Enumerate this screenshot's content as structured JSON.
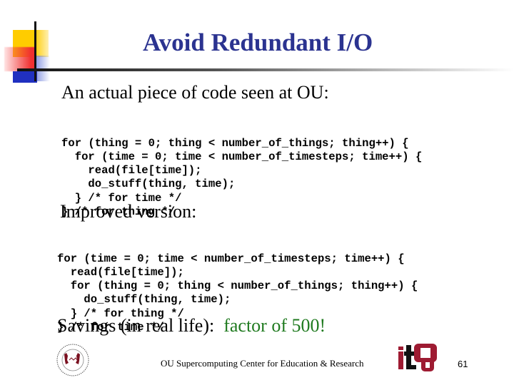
{
  "slide": {
    "title": "Avoid Redundant I/O",
    "intro": "An actual piece of code seen at OU:",
    "original_code": [
      "for (thing = 0; thing < number_of_things; thing++) {",
      "  for (time = 0; time < number_of_timesteps; time++) {",
      "    read(file[time]);",
      "    do_stuff(thing, time);",
      "  } /* for time */",
      "} /* for thing */"
    ],
    "improved_label": "Improved version:",
    "improved_code": [
      "for (time = 0; time < number_of_timesteps; time++) {",
      "  read(file[time]);",
      "  for (thing = 0; thing < number_of_things; thing++) {",
      "    do_stuff(thing, time);",
      "  } /* for thing */",
      "} /* for time */"
    ],
    "savings_label": "Savings (in real life):",
    "savings_value": "factor of 500!"
  },
  "footer": {
    "org_text": "OU Supercomputing Center for Education & Research",
    "page_number": "61",
    "logos": [
      "oscer-seal-logo",
      "itou-logo"
    ]
  },
  "colors": {
    "title": "#2b3390",
    "highlight": "#1f7a1f",
    "ou_crimson": "#9e1b32"
  }
}
